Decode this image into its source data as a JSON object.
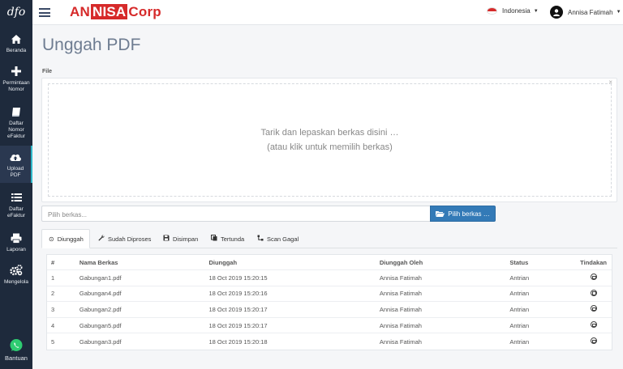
{
  "sidebar": {
    "logo": "dfo",
    "items": [
      {
        "label": "Beranda",
        "icon": "home-icon"
      },
      {
        "label": "Permintaan Nomor",
        "icon": "plus-icon"
      },
      {
        "label": "Daftar Nomor eFaktur",
        "icon": "book-icon"
      },
      {
        "label": "Upload PDF",
        "icon": "cloud-upload-icon"
      },
      {
        "label": "Daftar eFaktur",
        "icon": "list-icon"
      },
      {
        "label": "Laporan",
        "icon": "print-icon"
      },
      {
        "label": "Mengelola",
        "icon": "gears-icon"
      },
      {
        "label": "Bantuan",
        "icon": "whatsapp-icon"
      }
    ]
  },
  "header": {
    "brand_part1": "AN",
    "brand_part2": "NISA",
    "brand_part3": "Corp",
    "language": "Indonesia",
    "user_name": "Annisa Fatimah"
  },
  "page": {
    "title": "Unggah PDF",
    "file_label": "File",
    "drop_line1": "Tarik dan lepaskan berkas disini …",
    "drop_line2": "(atau klik untuk memilih berkas)",
    "drop_close": "×",
    "file_placeholder": "Pilih berkas...",
    "browse_label": "Pilih berkas …"
  },
  "tabs": [
    {
      "label": "Diunggah",
      "icon": "circle-icon"
    },
    {
      "label": "Sudah Diproses",
      "icon": "wrench-icon"
    },
    {
      "label": "Disimpan",
      "icon": "save-icon"
    },
    {
      "label": "Tertunda",
      "icon": "copy-icon"
    },
    {
      "label": "Scan Gagal",
      "icon": "warning-icon"
    }
  ],
  "table": {
    "headers": [
      "#",
      "Nama Berkas",
      "Diunggah",
      "Diunggah Oleh",
      "Status",
      "Tindakan"
    ],
    "rows": [
      {
        "no": "1",
        "name": "Gabungan1.pdf",
        "date": "18 Oct 2019 15:20:15",
        "by": "Annisa Fatimah",
        "status": "Antrian"
      },
      {
        "no": "2",
        "name": "Gabungan4.pdf",
        "date": "18 Oct 2019 15:20:16",
        "by": "Annisa Fatimah",
        "status": "Antrian"
      },
      {
        "no": "3",
        "name": "Gabungan2.pdf",
        "date": "18 Oct 2019 15:20:17",
        "by": "Annisa Fatimah",
        "status": "Antrian"
      },
      {
        "no": "4",
        "name": "Gabungan5.pdf",
        "date": "18 Oct 2019 15:20:17",
        "by": "Annisa Fatimah",
        "status": "Antrian"
      },
      {
        "no": "5",
        "name": "Gabungan3.pdf",
        "date": "18 Oct 2019 15:20:18",
        "by": "Annisa Fatimah",
        "status": "Antrian"
      }
    ]
  },
  "colors": {
    "brand_red": "#d62a2a",
    "sidebar_bg": "#1e2a3c",
    "primary_button": "#337ab7",
    "active_accent": "#2fb8c9"
  }
}
